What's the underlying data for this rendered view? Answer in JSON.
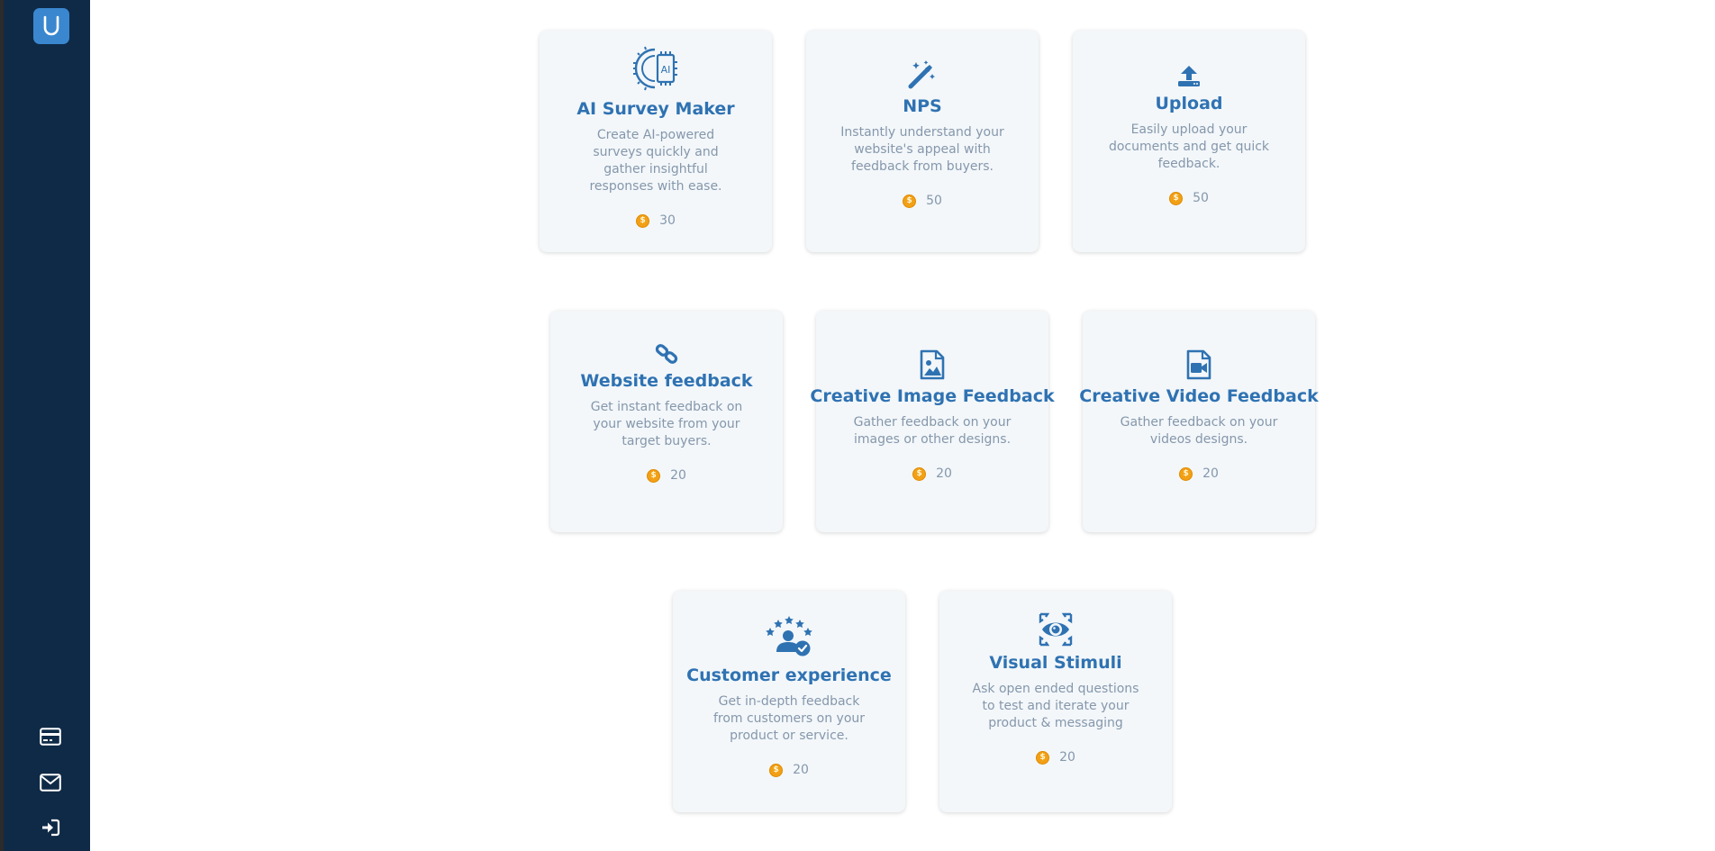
{
  "sidebar": {
    "logo_letter": "U",
    "items": [
      {
        "name": "billing",
        "icon": "credit-card-icon"
      },
      {
        "name": "messages",
        "icon": "envelope-icon"
      },
      {
        "name": "logout",
        "icon": "sign-in-icon"
      }
    ]
  },
  "colors": {
    "sidebar_bg": "#0f2a47",
    "accent": "#2f72b2",
    "card_bg": "#f3f7fa",
    "desc_text": "#8597ab",
    "coin": "#f2a015"
  },
  "cards": [
    {
      "title": "AI Survey Maker",
      "desc": "Create AI-powered surveys quickly and gather insightful responses with ease.",
      "cost": "30",
      "icon": "ai-chip-icon"
    },
    {
      "title": "NPS",
      "desc": "Instantly understand your website's appeal with feedback from buyers.",
      "cost": "50",
      "icon": "magic-wand-icon"
    },
    {
      "title": "Upload",
      "desc": "Easily upload your documents and get quick feedback.",
      "cost": "50",
      "icon": "upload-icon"
    },
    {
      "title": "Website feedback",
      "desc": "Get instant feedback on your website from your target buyers.",
      "cost": "20",
      "icon": "link-icon"
    },
    {
      "title": "Creative Image Feedback",
      "desc": "Gather feedback on your images or other designs.",
      "cost": "20",
      "icon": "image-file-icon"
    },
    {
      "title": "Creative Video Feedback",
      "desc": "Gather feedback on your videos designs.",
      "cost": "20",
      "icon": "video-file-icon"
    },
    {
      "title": "Customer experience",
      "desc": "Get in-depth feedback from customers on your product or service.",
      "cost": "20",
      "icon": "customer-rating-icon"
    },
    {
      "title": "Visual Stimuli",
      "desc": "Ask open ended questions to test and iterate your product & messaging",
      "cost": "20",
      "icon": "eye-target-icon"
    }
  ],
  "coin_symbol": "$"
}
